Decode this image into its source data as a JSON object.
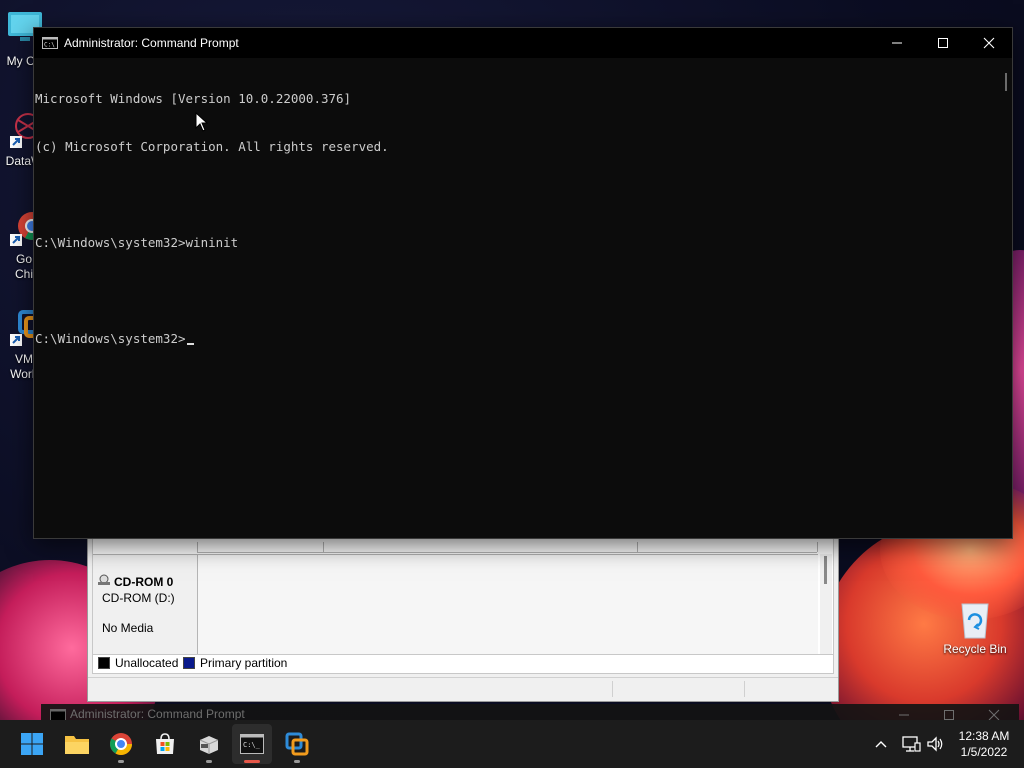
{
  "desktop": {
    "icons": [
      {
        "label": "My Co",
        "icon": "this-pc-icon"
      },
      {
        "label": "DataW",
        "icon": "datawarrior-icon"
      },
      {
        "label": "Go",
        "label2": "Chi",
        "icon": "chrome-desktop-icon"
      },
      {
        "label": "VM",
        "label2": "Work",
        "icon": "vmware-desktop-icon"
      },
      {
        "label": "Recycle Bin",
        "icon": "recycle-bin-icon"
      }
    ]
  },
  "disk_management": {
    "disk_title": "CD-ROM 0",
    "disk_type": "CD-ROM (D:)",
    "disk_media": "No Media",
    "legend": [
      {
        "label": "Unallocated",
        "color": "#000000"
      },
      {
        "label": "Primary partition",
        "color": "#0a1a8c"
      }
    ]
  },
  "cmd_window": {
    "title": "Administrator: Command Prompt",
    "lines": [
      "Microsoft Windows [Version 10.0.22000.376]",
      "(c) Microsoft Corporation. All rights reserved.",
      "",
      "C:\\Windows\\system32>wininit",
      "",
      "C:\\Windows\\system32>"
    ],
    "buttons": {
      "minimize": "minimize-icon",
      "maximize": "maximize-icon",
      "close": "close-icon"
    }
  },
  "background_window_bar": {
    "title": "Administrator: Command Prompt"
  },
  "taskbar": {
    "apps": [
      {
        "name": "start",
        "icon": "windows-start-icon"
      },
      {
        "name": "file-explorer",
        "icon": "folder-icon"
      },
      {
        "name": "chrome",
        "icon": "chrome-icon"
      },
      {
        "name": "microsoft-store",
        "icon": "store-icon"
      },
      {
        "name": "app-installer",
        "icon": "installer-icon"
      },
      {
        "name": "command-prompt",
        "icon": "cmd-icon",
        "active": true
      },
      {
        "name": "vmware",
        "icon": "vmware-icon"
      }
    ],
    "tray": {
      "chevron": "chevron-up-icon",
      "network": "network-icon",
      "volume": "volume-icon"
    },
    "clock": {
      "time": "12:38 AM",
      "date": "1/5/2022"
    }
  },
  "colors": {
    "accent": "#0078d4",
    "console_bg": "#0c0c0c",
    "console_fg": "#cccccc"
  }
}
